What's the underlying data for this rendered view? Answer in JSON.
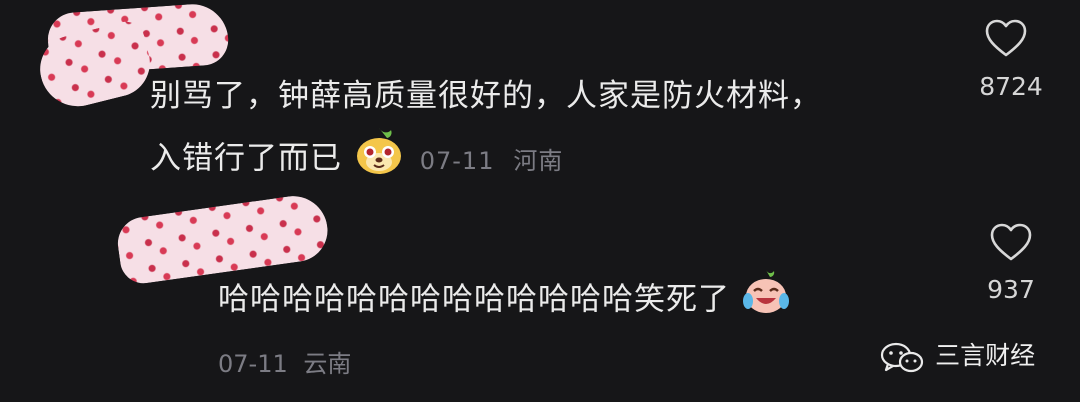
{
  "comments": [
    {
      "text_line1": "别骂了，钟薛高质量很好的，人家是防火材料，",
      "text_line2": "入错行了而已",
      "emoji": "dog-face-emoji",
      "date": "07-11",
      "location": "河南",
      "likes": "8724"
    },
    {
      "text": "哈哈哈哈哈哈哈哈哈哈哈哈哈笑死了",
      "emoji": "laughing-crying-emoji",
      "date": "07-11",
      "location": "云南",
      "likes": "937"
    }
  ],
  "watermark": {
    "label": "三言财经",
    "icon": "wechat-icon"
  },
  "colors": {
    "background": "#161618",
    "text": "#ebebeb",
    "meta": "#7c7c84"
  }
}
